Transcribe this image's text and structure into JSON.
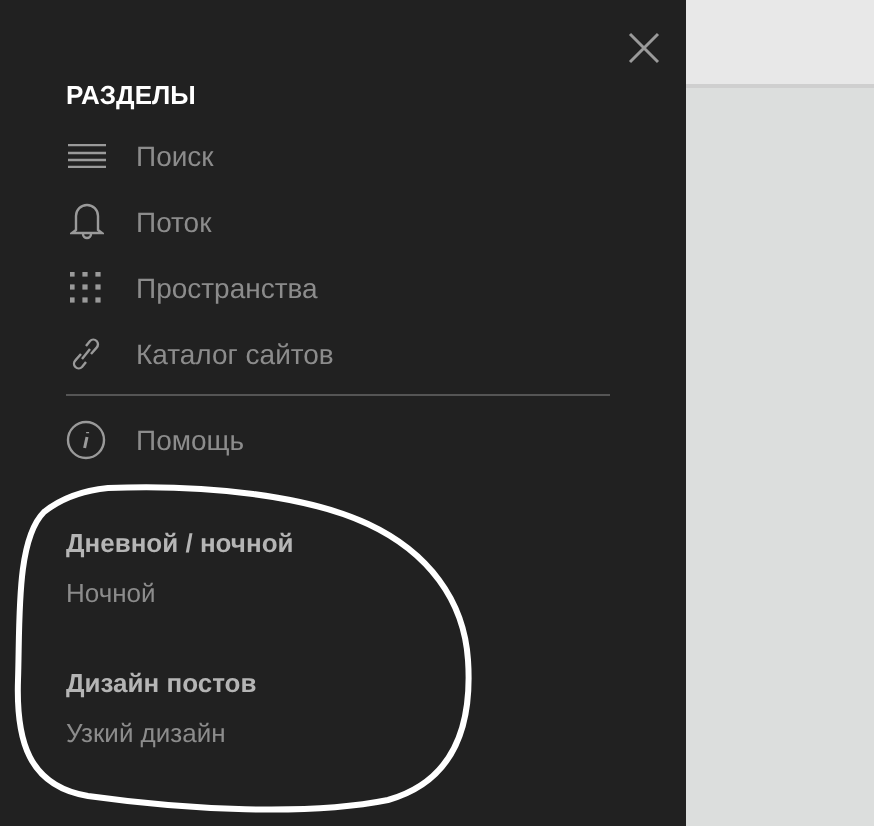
{
  "sidebar": {
    "heading": "РАЗДЕЛЫ",
    "items": [
      {
        "label": "Поиск"
      },
      {
        "label": "Поток"
      },
      {
        "label": "Пространства"
      },
      {
        "label": "Каталог сайтов"
      }
    ],
    "help": {
      "label": "Помощь"
    },
    "settings": [
      {
        "title": "Дневной / ночной",
        "value": "Ночной"
      },
      {
        "title": "Дизайн постов",
        "value": "Узкий дизайн"
      }
    ]
  }
}
